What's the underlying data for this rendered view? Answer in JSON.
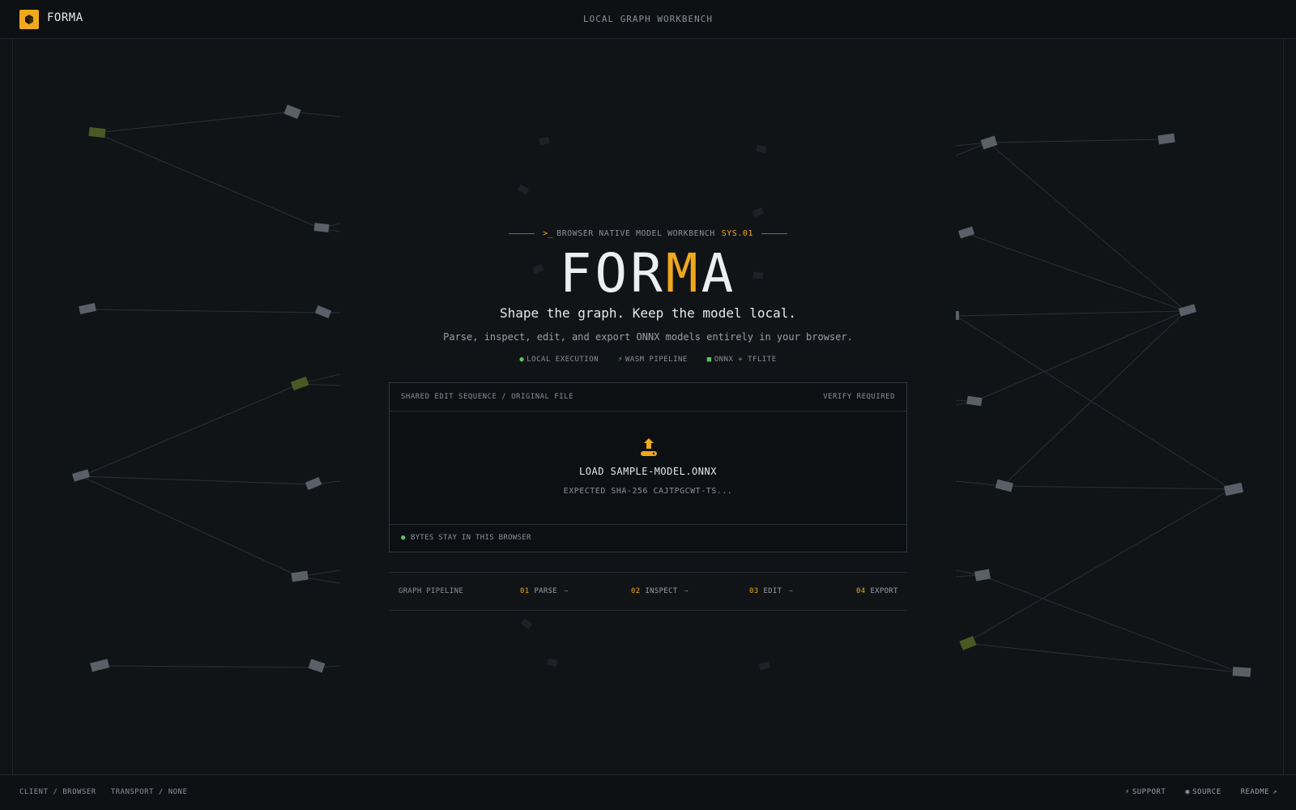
{
  "header": {
    "brand": "FORMA",
    "subtitle": "LOCAL GRAPH WORKBENCH",
    "logo_icon": "cube-icon"
  },
  "hero": {
    "eyebrow": "BROWSER NATIVE MODEL WORKBENCH",
    "eyebrow_code": "SYS.01",
    "title_part1": "FOR",
    "title_accent": "M",
    "title_part2": "A",
    "tagline": "Shape the graph. Keep the model local.",
    "description": "Parse, inspect, edit, and export ONNX models entirely in your browser."
  },
  "badges": [
    {
      "icon": "lock-icon",
      "label": "LOCAL EXECUTION"
    },
    {
      "icon": "bolt-icon",
      "label": "WASM PIPELINE"
    },
    {
      "icon": "cube-icon",
      "label": "ONNX + TFLITE"
    }
  ],
  "card": {
    "header_left": "SHARED EDIT SEQUENCE / ORIGINAL FILE",
    "header_right": "VERIFY REQUIRED",
    "action_label": "LOAD SAMPLE-MODEL.ONNX",
    "expected": "EXPECTED SHA-256 CAJTPGCWT-TS...",
    "footer": "BYTES STAY IN THIS BROWSER"
  },
  "pipeline": {
    "label": "GRAPH PIPELINE",
    "steps": [
      {
        "num": "01",
        "label": "PARSE"
      },
      {
        "num": "02",
        "label": "INSPECT"
      },
      {
        "num": "03",
        "label": "EDIT"
      },
      {
        "num": "04",
        "label": "EXPORT"
      }
    ]
  },
  "footer": {
    "client": "CLIENT / BROWSER",
    "transport": "TRANSPORT / NONE",
    "links": [
      {
        "icon": "bolt-icon",
        "label": "SUPPORT"
      },
      {
        "icon": "github-icon",
        "label": "SOURCE"
      },
      {
        "icon": "external-link-icon",
        "label": "README"
      }
    ]
  },
  "colors": {
    "accent": "#f0a81c",
    "background": "#111417",
    "success": "#5fbf6a"
  }
}
